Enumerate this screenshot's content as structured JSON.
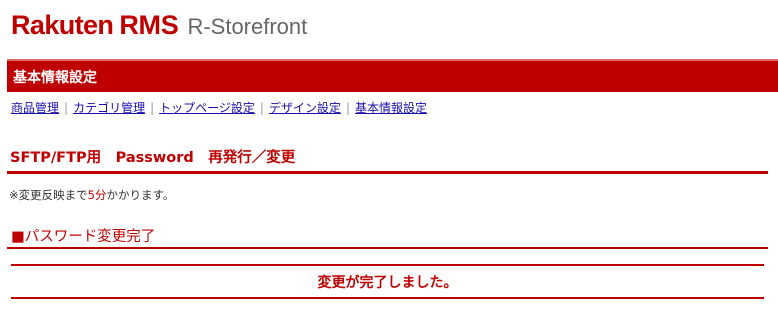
{
  "header": {
    "brand": "Rakuten",
    "rms": "RMS",
    "product": "R-Storefront"
  },
  "titlebar": {
    "title": "基本情報設定"
  },
  "nav": {
    "items": [
      {
        "label": "商品管理"
      },
      {
        "label": "カテゴリ管理"
      },
      {
        "label": "トップページ設定"
      },
      {
        "label": "デザイン設定"
      },
      {
        "label": "基本情報設定"
      }
    ],
    "separator": "|"
  },
  "section": {
    "title": "SFTP/FTP用　Password　再発行／変更"
  },
  "notice": {
    "prefix": "※変更反映まで",
    "highlight": "5分",
    "suffix": "かかります。"
  },
  "result": {
    "heading": "■パスワード変更完了",
    "message": "変更が完了しました。"
  },
  "colors": {
    "accent": "#bf0000",
    "link": "#1a0dab"
  }
}
